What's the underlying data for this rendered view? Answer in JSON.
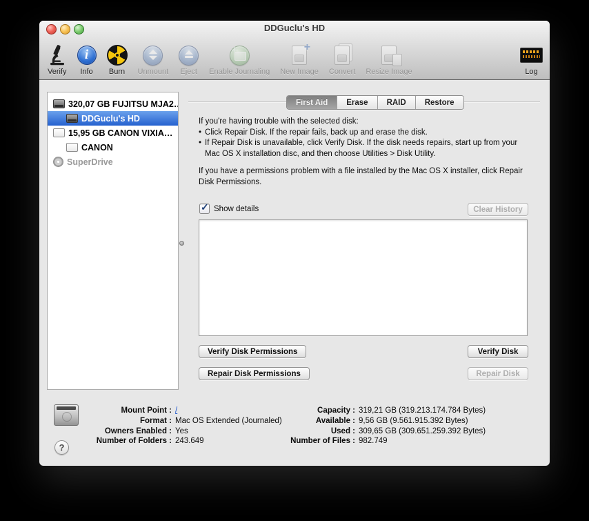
{
  "window": {
    "title": "DDGuclu's HD"
  },
  "colors": {
    "selection_blue": "#2f66d0",
    "link_blue": "#1a53cc",
    "log_warning_orange": "#f0a51e",
    "chrome_gray": "#d6d6d6",
    "content_gray": "#e7e7e7"
  },
  "icons": {
    "info_glyph": "i",
    "help_glyph": "?",
    "check_glyph": "✓",
    "bullet_glyph": "•",
    "plus_glyph": "+"
  },
  "toolbar": {
    "items": [
      {
        "label": "Verify",
        "icon": "microscope-icon",
        "enabled": true
      },
      {
        "label": "Info",
        "icon": "info-icon",
        "enabled": true
      },
      {
        "label": "Burn",
        "icon": "burn-icon",
        "enabled": true
      },
      {
        "label": "Unmount",
        "icon": "unmount-icon",
        "enabled": false
      },
      {
        "label": "Eject",
        "icon": "eject-icon",
        "enabled": false
      },
      {
        "label": "Enable Journaling",
        "icon": "enable-journaling-icon",
        "enabled": false
      },
      {
        "label": "New Image",
        "icon": "new-image-icon",
        "enabled": false
      },
      {
        "label": "Convert",
        "icon": "convert-icon",
        "enabled": false
      },
      {
        "label": "Resize Image",
        "icon": "resize-image-icon",
        "enabled": false
      }
    ],
    "log": {
      "label": "Log",
      "icon": "log-console-icon",
      "enabled": true
    }
  },
  "sidebar": {
    "items": [
      {
        "label": "320,07 GB FUJITSU MJA2…",
        "type": "internal-disk",
        "selected": false,
        "disabled": false
      },
      {
        "label": "DDGuclu's HD",
        "type": "volume",
        "selected": true,
        "disabled": false
      },
      {
        "label": "15,95 GB CANON VIXIA…",
        "type": "external-disk",
        "selected": false,
        "disabled": false
      },
      {
        "label": "CANON",
        "type": "external-volume",
        "selected": false,
        "disabled": false
      },
      {
        "label": "SuperDrive",
        "type": "optical-drive",
        "selected": false,
        "disabled": true
      }
    ]
  },
  "tabs": [
    {
      "label": "First Aid",
      "selected": true
    },
    {
      "label": "Erase",
      "selected": false
    },
    {
      "label": "RAID",
      "selected": false
    },
    {
      "label": "Restore",
      "selected": false
    }
  ],
  "first_aid": {
    "intro": "If you're having trouble with the selected disk:",
    "bullets": [
      "Click Repair Disk. If the repair fails, back up and erase the disk.",
      "If Repair Disk is unavailable, click Verify Disk. If the disk needs repairs, start up from your Mac OS X installation disc, and then choose Utilities > Disk Utility."
    ],
    "permissions_note": "If you have a permissions problem with a file installed by the Mac OS X installer, click Repair Disk Permissions.",
    "show_details_label": "Show details",
    "show_details_checked": true,
    "clear_history_label": "Clear History",
    "details_text": "",
    "buttons": {
      "verify_permissions": "Verify Disk Permissions",
      "repair_permissions": "Repair Disk Permissions",
      "verify_disk": "Verify Disk",
      "repair_disk": "Repair Disk"
    }
  },
  "info": {
    "left": [
      {
        "label": "Mount Point :",
        "value": "/"
      },
      {
        "label": "Format :",
        "value": "Mac OS Extended (Journaled)"
      },
      {
        "label": "Owners Enabled :",
        "value": "Yes"
      },
      {
        "label": "Number of Folders :",
        "value": "243.649"
      }
    ],
    "right": [
      {
        "label": "Capacity :",
        "value": "319,21 GB (319.213.174.784 Bytes)"
      },
      {
        "label": "Available :",
        "value": "9,56 GB (9.561.915.392 Bytes)"
      },
      {
        "label": "Used :",
        "value": "309,65 GB (309.651.259.392 Bytes)"
      },
      {
        "label": "Number of Files :",
        "value": "982.749"
      }
    ]
  }
}
